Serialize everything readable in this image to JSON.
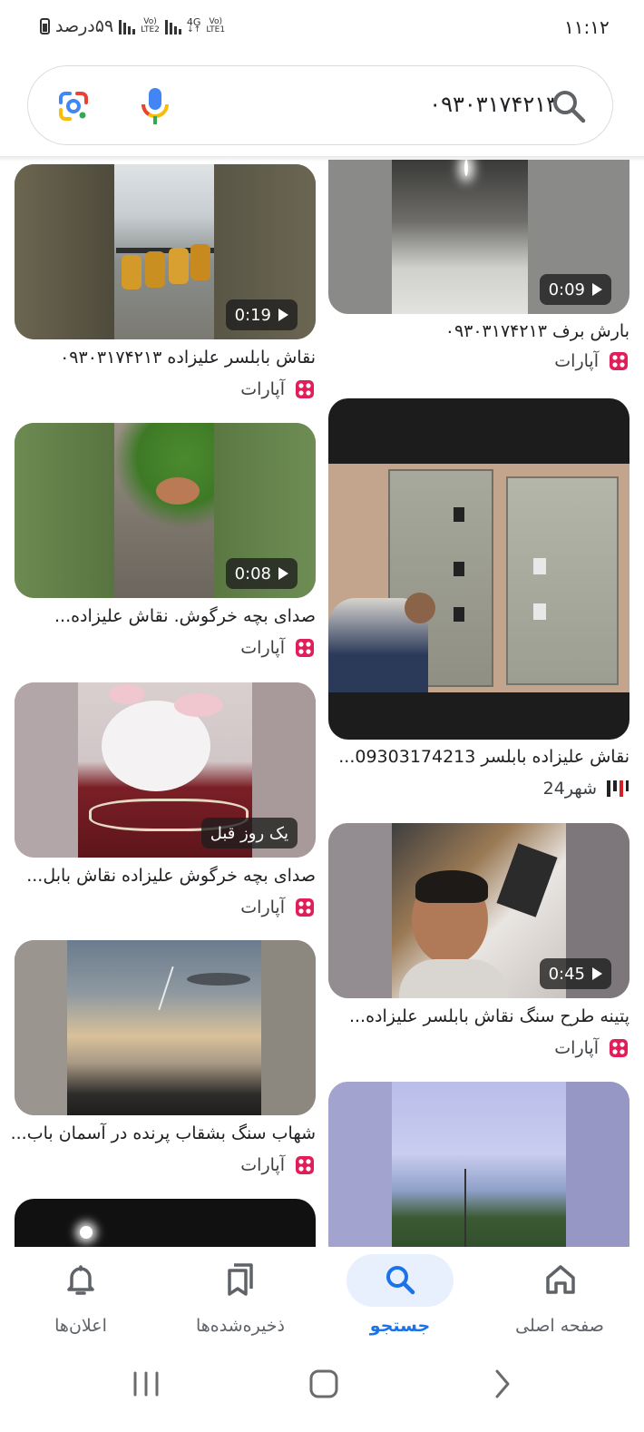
{
  "status_bar": {
    "time": "۱۱:۱۲",
    "battery_text": "۵۹درصد",
    "sim2_label_top": "Vo)",
    "sim2_label_bottom": "LTE2",
    "net_label_top": "4G",
    "net_label_bottom": "↓↑",
    "sim1_label_top": "Vo)",
    "sim1_label_bottom": "LTE1"
  },
  "search": {
    "query": "۰۹۳۰۳۱۷۴۲۱۳",
    "icons": [
      "google-lens-icon",
      "microphone-icon",
      "search-icon"
    ]
  },
  "results": [
    {
      "title": "نقاش بابلسر علیزاده ۰۹۳۰۳۱۷۴۲۱۳",
      "source": "آپارات",
      "badge": "0:19"
    },
    {
      "title": "بارش برف ۰۹۳۰۳۱۷۴۲۱۳",
      "source": "آپارات",
      "badge": "0:09"
    },
    {
      "title": "صدای بچه خرگوش. نقاش علیزاده...",
      "source": "آپارات",
      "badge": "0:08"
    },
    {
      "title": "نقاش علیزاده بابلسر 09303174213...",
      "source": "شهر24",
      "badge": ""
    },
    {
      "title": "صدای بچه خرگوش علیزاده نقاش بابل...",
      "source": "آپارات",
      "badge": "یک روز قبل"
    },
    {
      "title": "پتینه طرح سنگ نقاش بابلسر علیزاده...",
      "source": "آپارات",
      "badge": "0:45"
    },
    {
      "title": "شهاب سنگ بشقاب پرنده در آسمان باب...",
      "source": "آپارات",
      "badge": ""
    }
  ],
  "bottom_nav": {
    "items": [
      {
        "label": "اعلان‌ها",
        "icon": "bell-icon"
      },
      {
        "label": "ذخیره‌شده‌ها",
        "icon": "bookmarks-icon"
      },
      {
        "label": "جستجو",
        "icon": "search-icon",
        "active": true
      },
      {
        "label": "صفحه اصلی",
        "icon": "home-icon"
      }
    ]
  },
  "colors": {
    "accent": "#1a73e8",
    "active_pill": "#e8f0fe",
    "aparat": "#e01f5a"
  }
}
